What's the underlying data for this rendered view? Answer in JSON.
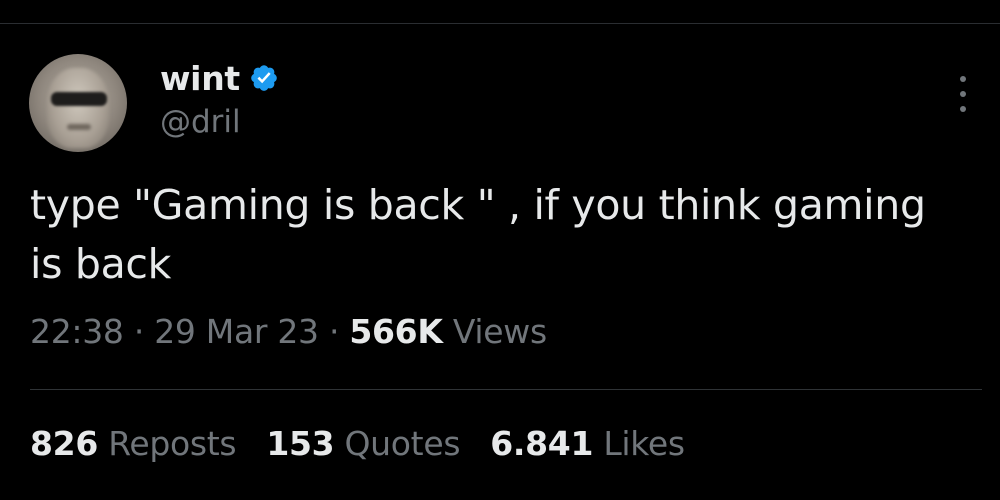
{
  "author": {
    "display_name": "wint",
    "handle": "@dril",
    "verified": true,
    "avatar_icon": "avatar-photo"
  },
  "tweet": {
    "text": "type \"Gaming is back \" , if you think gaming is back"
  },
  "meta": {
    "time": "22:38",
    "separator_1": "·",
    "date": "29 Mar 23",
    "separator_2": "·",
    "views_count": "566K",
    "views_label": "Views"
  },
  "stats": {
    "reposts_count": "826",
    "reposts_label": "Reposts",
    "quotes_count": "153",
    "quotes_label": "Quotes",
    "likes_count": "6.841",
    "likes_label": "Likes"
  },
  "icons": {
    "verified": "verified-badge-icon",
    "more": "more-options-icon"
  },
  "colors": {
    "background": "#000000",
    "primary_text": "#e7e9ea",
    "secondary_text": "#71767b",
    "verified_blue": "#1d9bf0",
    "divider": "#2f3336"
  }
}
